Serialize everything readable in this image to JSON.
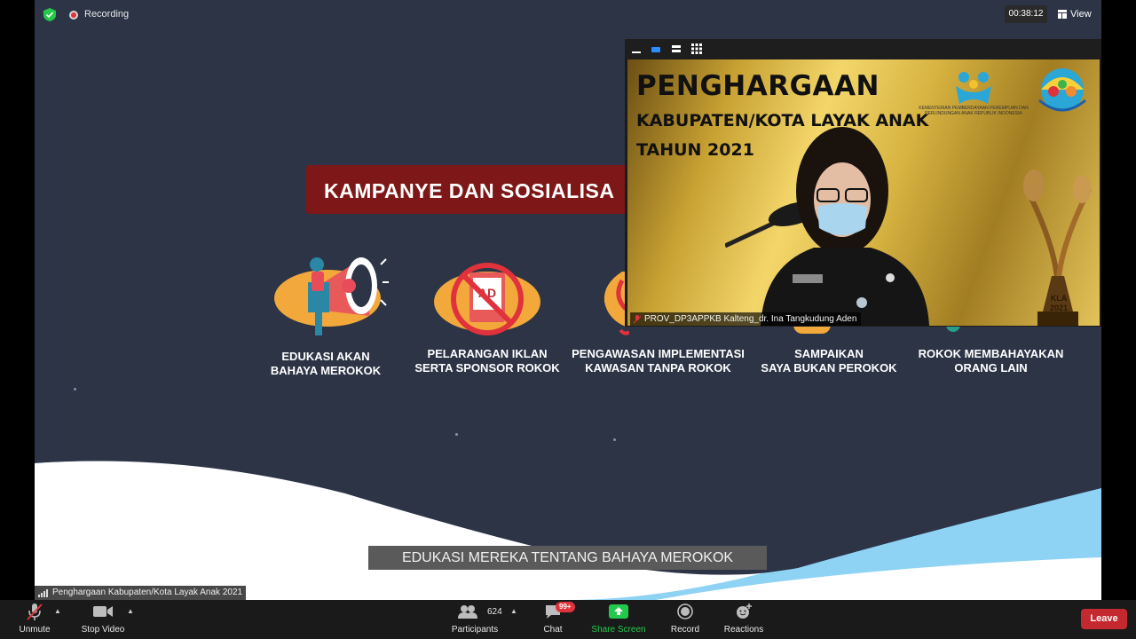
{
  "top_bar": {
    "recording_label": "Recording",
    "timer": "00:38:12",
    "view_label": "View"
  },
  "slide": {
    "title": "KAMPANYE DAN SOSIALISA",
    "items": [
      {
        "line1": "EDUKASI AKAN",
        "line2": "BAHAYA MEROKOK"
      },
      {
        "line1": "PELARANGAN IKLAN",
        "line2": "SERTA SPONSOR ROKOK"
      },
      {
        "line1": "PENGAWASAN IMPLEMENTASI",
        "line2": "KAWASAN TANPA ROKOK"
      },
      {
        "line1": "SAMPAIKAN",
        "line2": "SAYA BUKAN PEROKOK"
      },
      {
        "line1": "ROKOK MEMBAHAYAKAN",
        "line2": "ORANG LAIN"
      }
    ],
    "ad_icon_text": "AD",
    "caption": "EDUKASI MEREKA TENTANG BAHAYA MEROKOK"
  },
  "video_tile": {
    "title_line1": "PENGHARGAAN",
    "title_line2": "KABUPATEN/KOTA LAYAK ANAK",
    "title_line3": "TAHUN 2021",
    "ministry_text": "KEMENTERIAN PEMBERDAYAAN PEREMPUAN DAN PERLINDUNGAN ANAK REPUBLIK INDONESIA",
    "trophy_text_1": "KLA",
    "trophy_text_2": "2021",
    "participant_name": "PROV_DP3APPKB Kalteng_dr. Ina Tangkudung Aden"
  },
  "meeting_tag": "Penghargaan Kabupaten/Kota Layak Anak 2021",
  "toolbar": {
    "unmute_label": "Unmute",
    "stop_video_label": "Stop Video",
    "participants_label": "Participants",
    "participants_count": "624",
    "chat_label": "Chat",
    "chat_badge": "99+",
    "share_label": "Share Screen",
    "record_label": "Record",
    "reactions_label": "Reactions",
    "leave_label": "Leave"
  },
  "colors": {
    "slide_bg": "#2c3446",
    "title_box": "#7e1717",
    "share_green": "#23c94b",
    "leave_red": "#c4292f",
    "recording_red": "#e0323c"
  },
  "icons": [
    "shield-icon",
    "recording-icon",
    "grid-view-icon",
    "microphone-muted-icon",
    "video-camera-icon",
    "participants-icon",
    "chat-icon",
    "share-screen-icon",
    "record-icon",
    "reaction-icon",
    "signal-icon"
  ]
}
